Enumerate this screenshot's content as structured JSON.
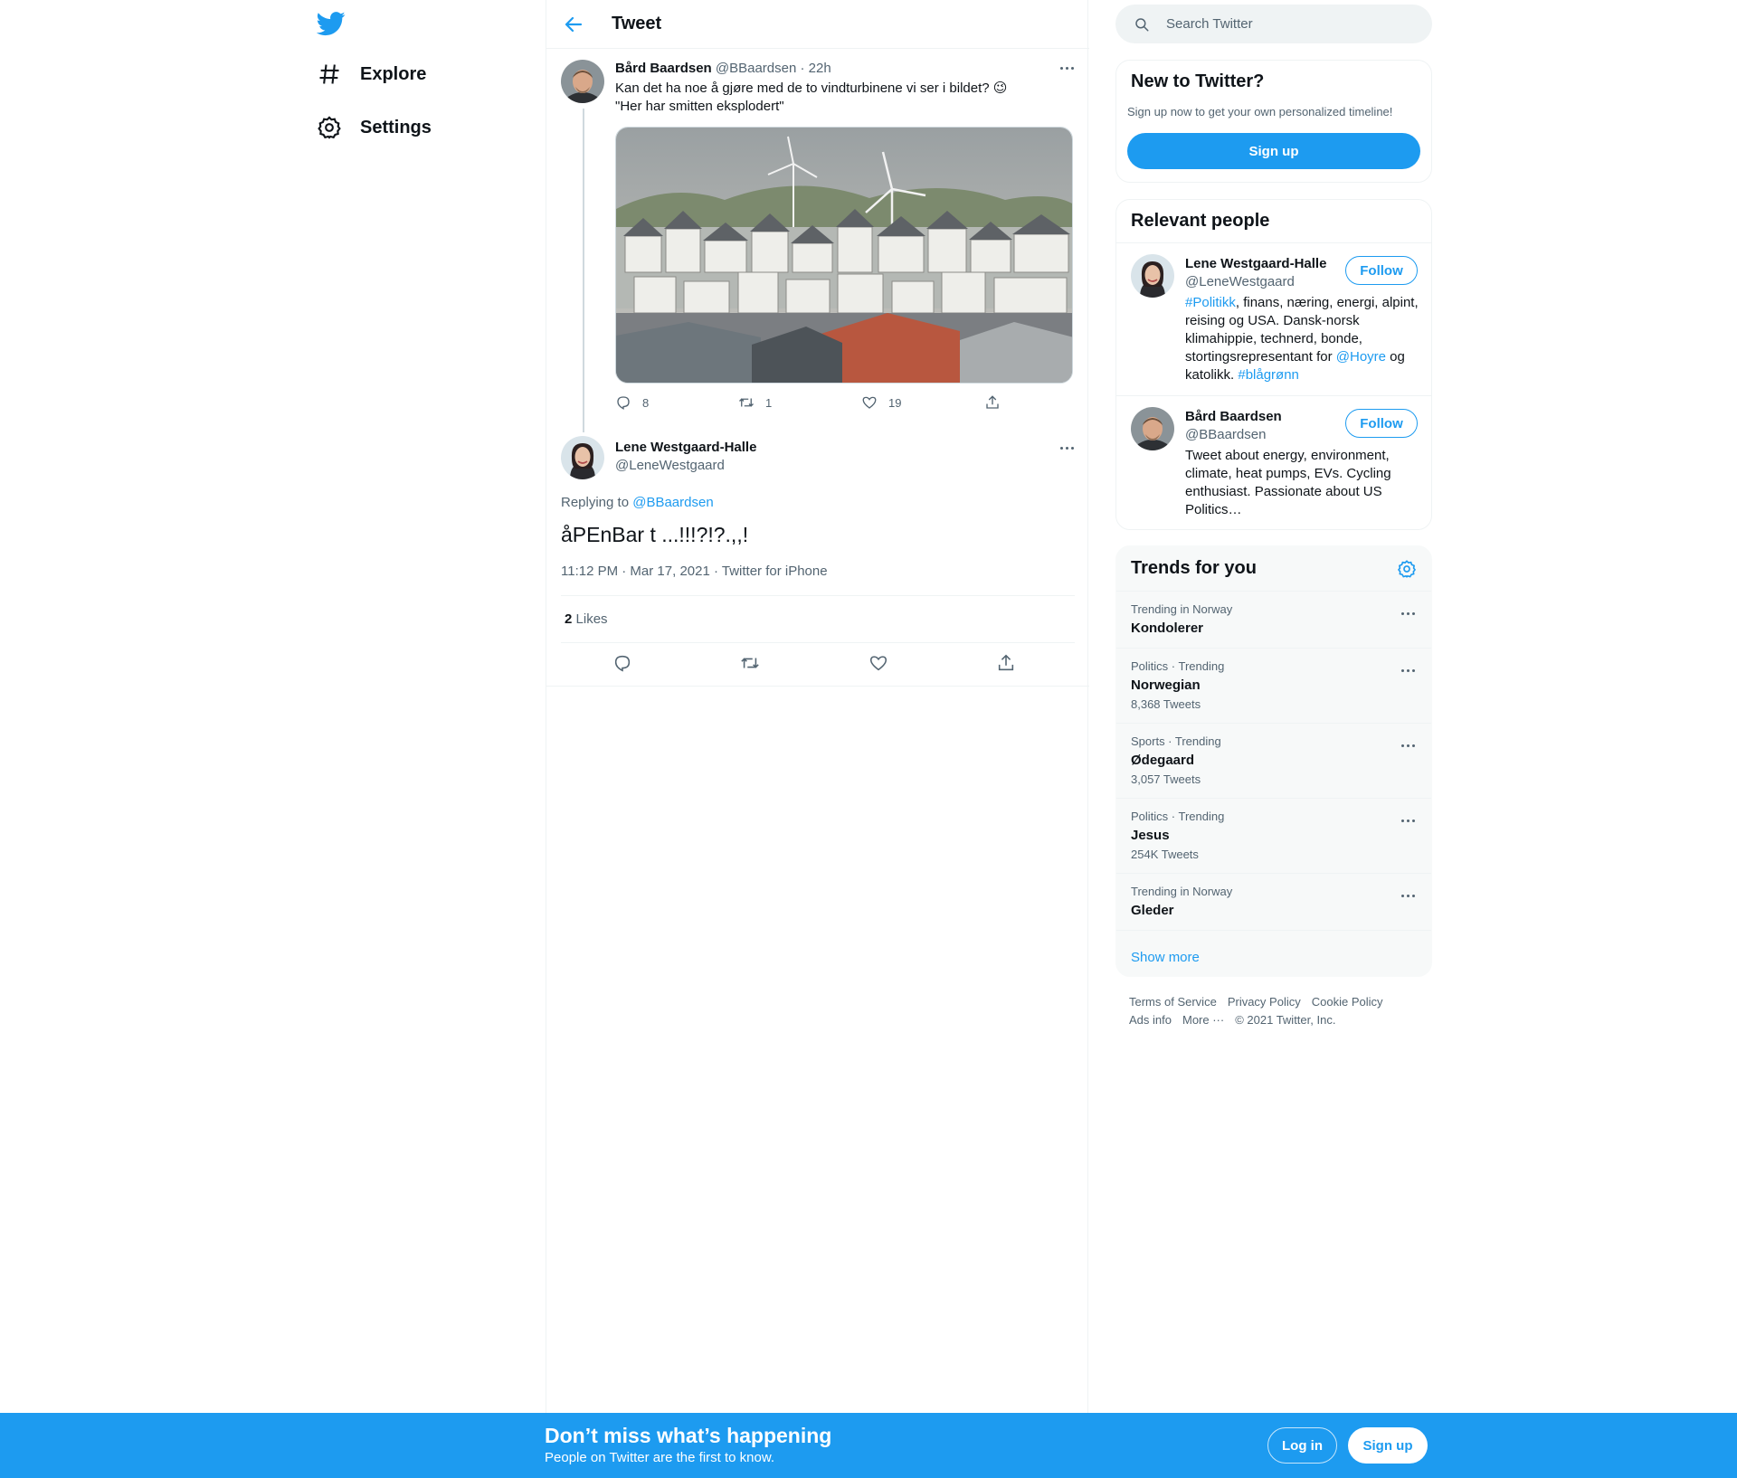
{
  "colors": {
    "accent": "#1d9bf0",
    "text": "#0f1419",
    "secondary": "#536471",
    "border": "#eff3f4"
  },
  "nav": {
    "logo_icon": "twitter-bird-icon",
    "items": [
      {
        "label": "Explore",
        "icon": "hashtag-icon"
      },
      {
        "label": "Settings",
        "icon": "gear-icon"
      }
    ]
  },
  "header": {
    "title": "Tweet",
    "back_icon": "arrow-left-icon"
  },
  "parent_tweet": {
    "name": "Bård Baardsen",
    "handle": "@BBaardsen",
    "time": "· 22h",
    "text_line1": "Kan det ha noe å gjøre med de to vindturbinene vi ser i bildet? 😉",
    "text_line2": "\"Her har smitten eksplodert\"",
    "replies": "8",
    "retweets": "1",
    "likes": "19"
  },
  "main_tweet": {
    "name": "Lene Westgaard-Halle",
    "handle": "@LeneWestgaard",
    "replying_prefix": "Replying to",
    "replying_to": "@BBaardsen",
    "text": "åPEnBar t ...!!!?!?.,,!",
    "meta": "11:12 PM · Mar 17, 2021 · Twitter for iPhone",
    "likes_count": "2",
    "likes_label": "Likes"
  },
  "search": {
    "placeholder": "Search Twitter"
  },
  "new_to_twitter": {
    "title": "New to Twitter?",
    "subtitle": "Sign up now to get your own personalized timeline!",
    "button": "Sign up"
  },
  "relevant_people": {
    "title": "Relevant people",
    "follow_label": "Follow",
    "people": [
      {
        "name": "Lene Westgaard-Halle",
        "handle": "@LeneWestgaard",
        "bio_parts": [
          "#Politikk",
          ", finans, næring, energi, alpint, reising og USA. Dansk-norsk klimahippie, technerd, bonde, stortingsrepresentant for ",
          "@Hoyre",
          " og katolikk. ",
          "#blågrønn"
        ]
      },
      {
        "name": "Bård Baardsen",
        "handle": "@BBaardsen",
        "bio": "Tweet about energy, environment, climate, heat pumps, EVs. Cycling enthusiast. Passionate about US Politics…"
      }
    ]
  },
  "trends": {
    "title": "Trends for you",
    "items": [
      {
        "context": "Trending in Norway",
        "name": "Kondolerer",
        "count": ""
      },
      {
        "context": "Politics · Trending",
        "name": "Norwegian",
        "count": "8,368 Tweets"
      },
      {
        "context": "Sports · Trending",
        "name": "Ødegaard",
        "count": "3,057 Tweets"
      },
      {
        "context": "Politics · Trending",
        "name": "Jesus",
        "count": "254K Tweets"
      },
      {
        "context": "Trending in Norway",
        "name": "Gleder",
        "count": ""
      }
    ],
    "show_more": "Show more"
  },
  "footer": {
    "links": [
      "Terms of Service",
      "Privacy Policy",
      "Cookie Policy",
      "Ads info",
      "More ···"
    ],
    "copyright": "© 2021 Twitter, Inc."
  },
  "bottom_bar": {
    "title": "Don’t miss what’s happening",
    "subtitle": "People on Twitter are the first to know.",
    "login": "Log in",
    "signup": "Sign up"
  }
}
